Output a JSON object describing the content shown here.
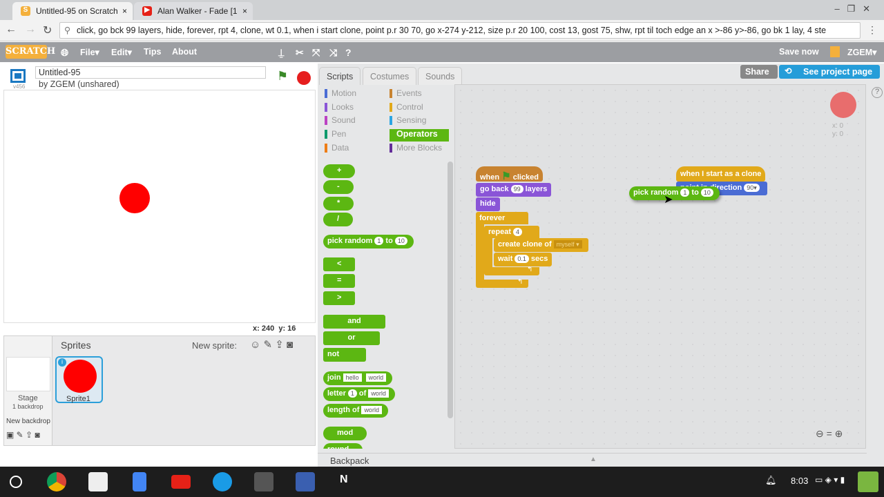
{
  "browser": {
    "tabs": [
      {
        "title": "Untitled-95 on Scratch",
        "close": "×"
      },
      {
        "title": "Alan Walker - Fade [1",
        "close": "×"
      }
    ],
    "address": "click, go bck 99 layers, hide, forever, rpt 4, clone, wt 0.1, when i start clone, point p.r 30 70, go x-274 y-212, size p.r 20 100, cost 13, gost 75, shw, rpt til toch edge an x >-86 y>-86, go bk 1 lay, 4 ste"
  },
  "menubar": {
    "logo": "SCRATCH",
    "items": [
      "File▾",
      "Edit▾",
      "Tips",
      "About"
    ],
    "save": "Save now",
    "user": "ZGEM▾"
  },
  "project": {
    "title": "Untitled-95",
    "author": "by ZGEM (unshared)",
    "version": "v456",
    "share": "Share",
    "see_page": "See project page"
  },
  "stage": {
    "coords_x": "x: 240",
    "coords_y": "y: 16",
    "sprite_color": "#ff0000"
  },
  "sprites": {
    "header": "Sprites",
    "new_sprite": "New sprite:",
    "stage_label": "Stage",
    "backdrops": "1 backdrop",
    "new_backdrop": "New backdrop",
    "sprite1": "Sprite1"
  },
  "tabs": [
    "Scripts",
    "Costumes",
    "Sounds"
  ],
  "categories": {
    "left": [
      "Motion",
      "Looks",
      "Sound",
      "Pen",
      "Data"
    ],
    "right": [
      "Events",
      "Control",
      "Sensing",
      "Operators",
      "More Blocks"
    ],
    "selected": "Operators"
  },
  "palette": {
    "plus": "+",
    "minus": "-",
    "times": "*",
    "divide": "/",
    "pick": "pick random",
    "pick_a": "1",
    "to": "to",
    "pick_b": "10",
    "lt": "<",
    "eq": "=",
    "gt": ">",
    "and": "and",
    "or": "or",
    "not": "not",
    "join": "join",
    "hello": "hello",
    "world": "world",
    "letter": "letter",
    "letter_n": "1",
    "of": "of",
    "length": "length of",
    "mod": "mod",
    "round": "round"
  },
  "script1": {
    "when": "when",
    "clicked": "clicked",
    "goback": "go back",
    "layers_n": "99",
    "layers": "layers",
    "hide": "hide",
    "forever": "forever",
    "repeat": "repeat",
    "repeat_n": "4",
    "clone": "create clone of",
    "myself": "myself ▾",
    "wait": "wait",
    "wait_n": "0.1",
    "secs": "secs"
  },
  "script2": {
    "hat": "when I start as a clone",
    "point": "point in direction",
    "dir": "90▾",
    "pick": "pick random",
    "a": "1",
    "to": "to",
    "b": "10"
  },
  "sprite_info": {
    "x": "x: 0",
    "y": "y: 0"
  },
  "backpack": "Backpack",
  "clock": "8:03"
}
